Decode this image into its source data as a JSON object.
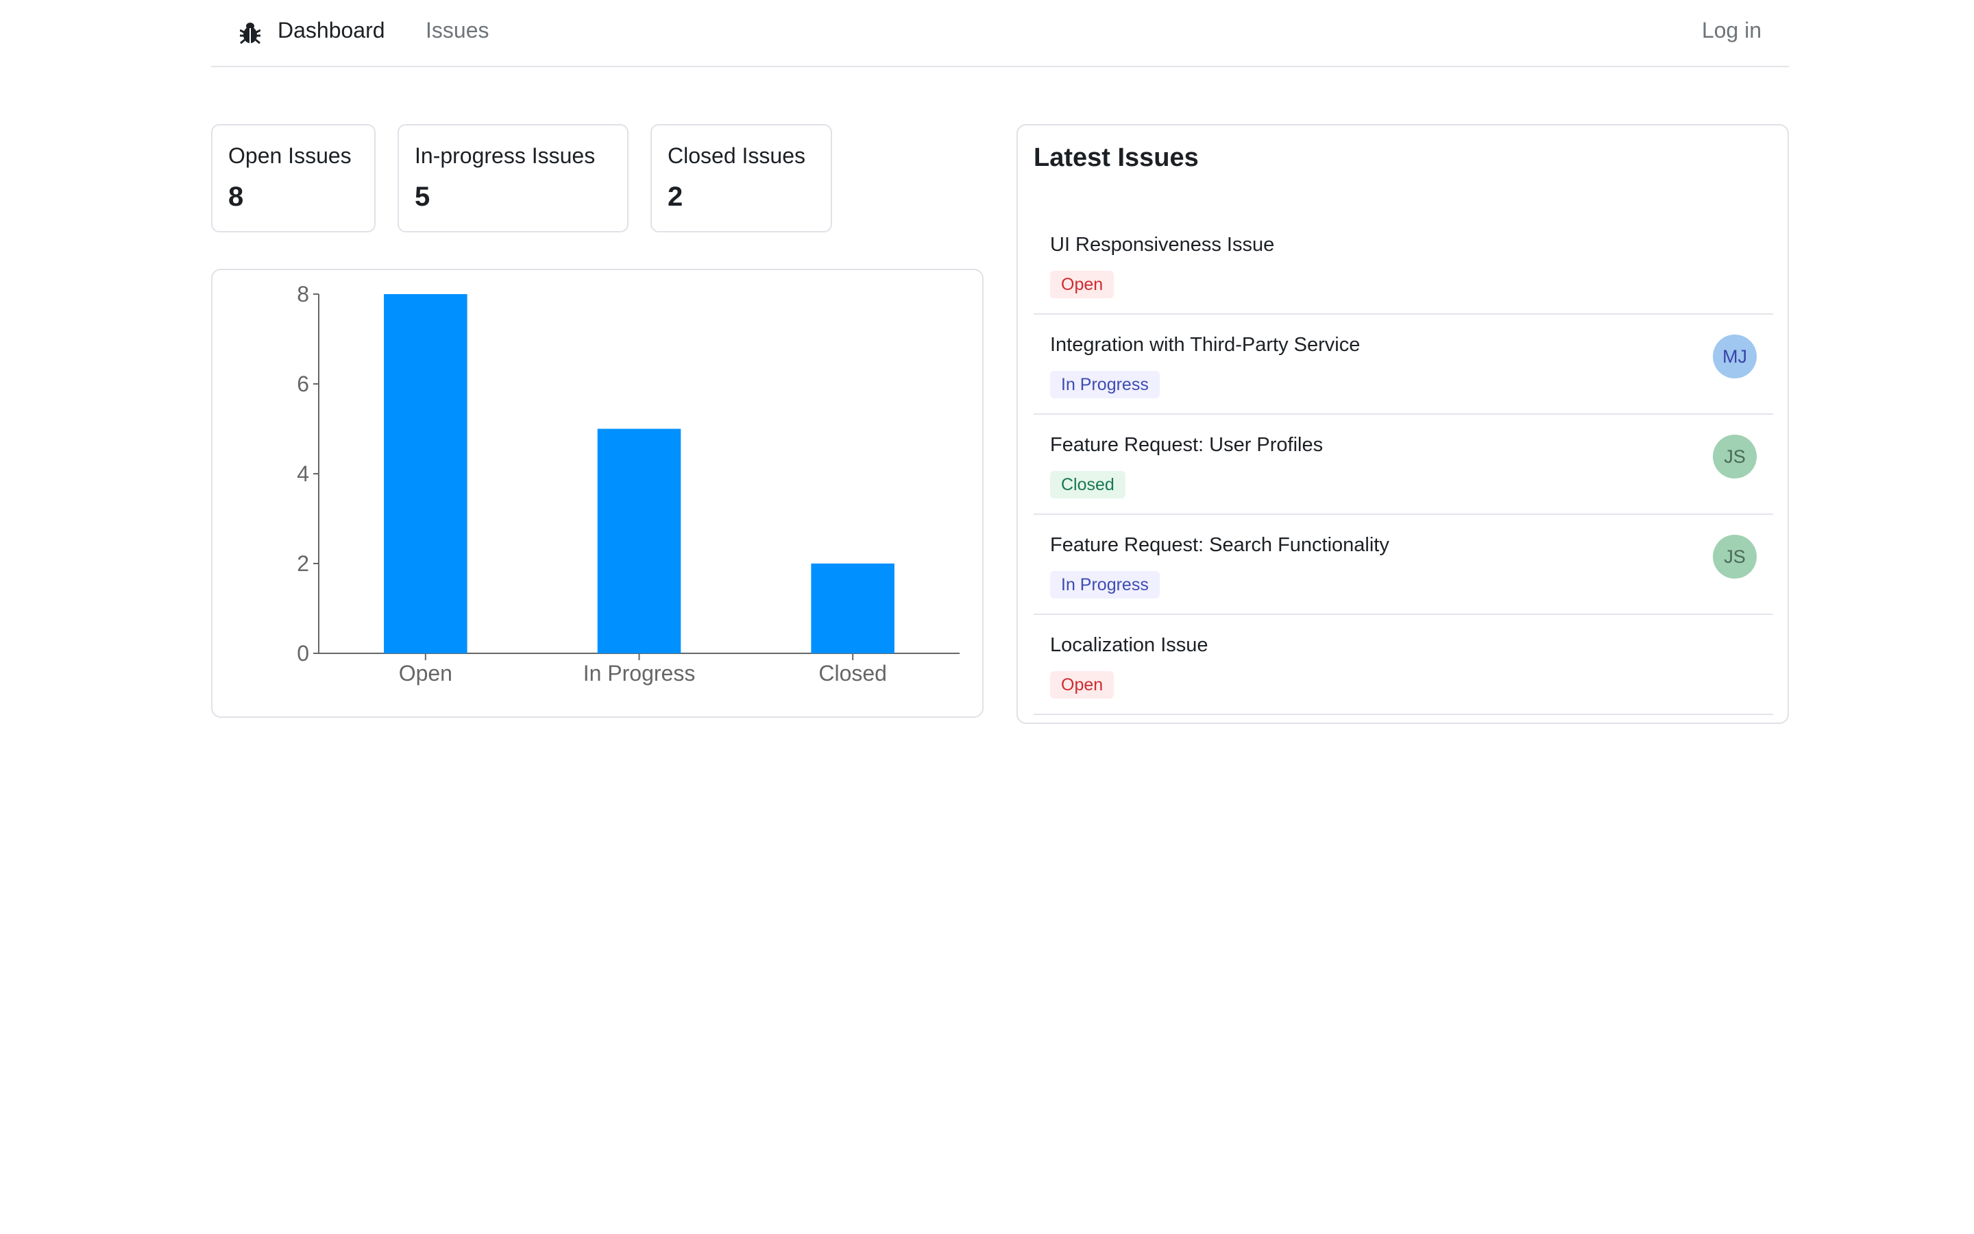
{
  "nav": {
    "logo_icon": "bug-icon",
    "dashboard_label": "Dashboard",
    "issues_label": "Issues",
    "login_label": "Log in"
  },
  "stats": [
    {
      "label": "Open Issues",
      "value": "8"
    },
    {
      "label": "In-progress Issues",
      "value": "5"
    },
    {
      "label": "Closed Issues",
      "value": "2"
    }
  ],
  "chart_data": {
    "type": "bar",
    "categories": [
      "Open",
      "In Progress",
      "Closed"
    ],
    "values": [
      8,
      5,
      2
    ],
    "title": "",
    "xlabel": "",
    "ylabel": "",
    "ylim": [
      0,
      8
    ],
    "yticks": [
      0,
      2,
      4,
      6,
      8
    ],
    "grid": false,
    "legend": "none",
    "bar_color": "#0090ff"
  },
  "latest": {
    "title": "Latest Issues",
    "issues": [
      {
        "title": "UI Responsiveness Issue",
        "status": "Open",
        "status_kind": "open",
        "assignee": ""
      },
      {
        "title": "Integration with Third-Party Service",
        "status": "In Progress",
        "status_kind": "progress",
        "assignee": "MJ"
      },
      {
        "title": "Feature Request: User Profiles",
        "status": "Closed",
        "status_kind": "closed",
        "assignee": "JS"
      },
      {
        "title": "Feature Request: Search Functionality",
        "status": "In Progress",
        "status_kind": "progress",
        "assignee": "JS"
      },
      {
        "title": "Localization Issue",
        "status": "Open",
        "status_kind": "open",
        "assignee": ""
      }
    ]
  }
}
